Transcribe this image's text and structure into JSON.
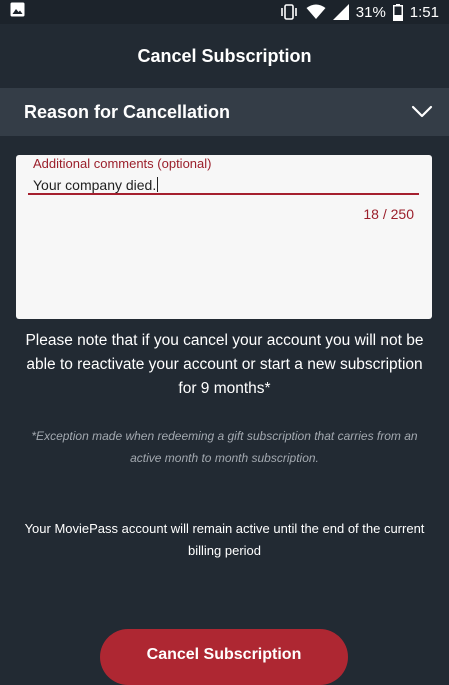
{
  "status_bar": {
    "battery_percent": "31%",
    "time": "1:51",
    "icons": [
      "image-icon",
      "vibrate-icon",
      "wifi-icon",
      "signal-icon",
      "battery-icon"
    ]
  },
  "app_bar": {
    "title": "Cancel Subscription"
  },
  "reason": {
    "label": "Reason for Cancellation",
    "icon": "chevron-down-icon"
  },
  "comments": {
    "label": "Additional comments (optional)",
    "value": "Your company died.",
    "counter": "18 / 250"
  },
  "notice": "Please note that if you cancel your account you will not be able to reactivate your account or start a new subscription for 9 months*",
  "exception": "*Exception made when redeeming a gift subscription that carries from an active month to month subscription.",
  "active_note": "Your MoviePass account will remain active until the end of the current billing period",
  "cancel_button": {
    "label": "Cancel Subscription"
  },
  "colors": {
    "background": "#222a33",
    "accent": "#ae2732",
    "reason_bar": "#343d47",
    "card": "#f7f7f7"
  }
}
